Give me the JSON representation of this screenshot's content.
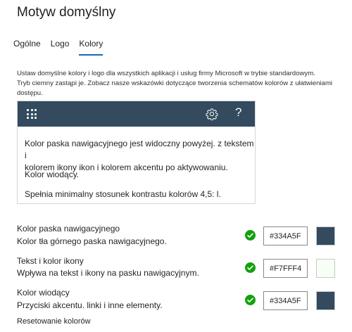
{
  "title": "Motyw domyślny",
  "tabs": [
    {
      "label": "Ogólne"
    },
    {
      "label": "Logo"
    },
    {
      "label": "Kolory"
    }
  ],
  "description": {
    "line1": "Ustaw domyślne kolory i logo dla wszystkich aplikacji i usług firmy Microsoft w trybie standardowym.",
    "line2": "Tryb ciemny zastąpi je. Zobacz nasze wskazówki dotyczące tworzenia schematów kolorów z ułatwieniami dostępu."
  },
  "preview": {
    "icons": [
      "waffle-icon",
      "gear-icon",
      "help-icon"
    ],
    "help_glyph": "?",
    "text1_line1": "Kolor paska nawigacyjnego jest widoczny powyżej. z tekstem i",
    "text1_line2": "kolorem ikony ikon i kolorem akcentu po aktywowaniu.",
    "text2": "Kolor wiodący.",
    "text3": "Spełnia minimalny stosunek kontrastu kolorów 4,5: l."
  },
  "colors": {
    "navbar": {
      "label": "Kolor paska nawigacyjnego",
      "sub": "Kolor tła górnego paska nawigacyjnego.",
      "value": "#334A5F",
      "swatch": "#334a5f"
    },
    "text_icon": {
      "label": "Tekst i kolor ikony",
      "sub": "Wpływa na tekst i ikony na pasku nawigacyjnym.",
      "value": "#F7FFF4",
      "swatch": "#f7fff4"
    },
    "accent": {
      "label": "Kolor wiodący",
      "sub": "Przyciski akcentu. linki i inne elementy.",
      "value": "#334A5F",
      "swatch": "#334a5f"
    },
    "check_color": "#13a10e"
  },
  "reset_label": "Resetowanie kolorów"
}
